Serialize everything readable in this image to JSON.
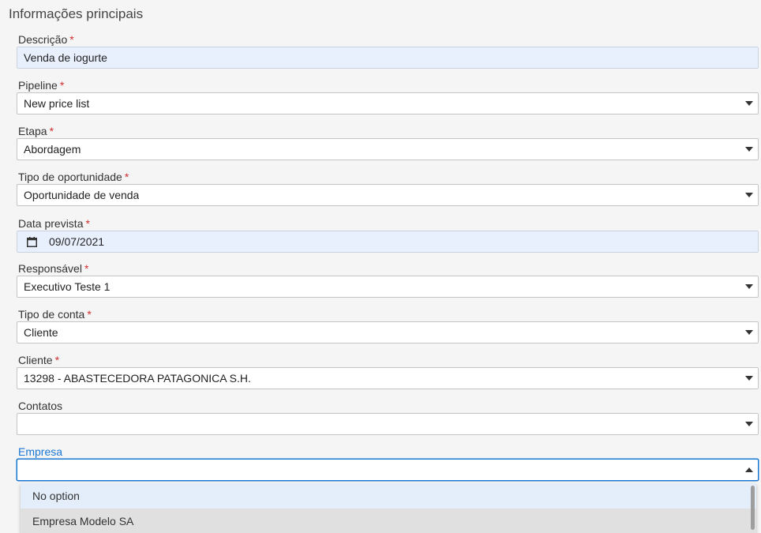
{
  "section": {
    "title": "Informações principais"
  },
  "required_marker": "*",
  "fields": {
    "descricao": {
      "label": "Descrição",
      "value": "Venda de iogurte"
    },
    "pipeline": {
      "label": "Pipeline",
      "value": "New price list"
    },
    "etapa": {
      "label": "Etapa",
      "value": "Abordagem"
    },
    "tipo_oportunidade": {
      "label": "Tipo de oportunidade",
      "value": "Oportunidade de venda"
    },
    "data_prevista": {
      "label": "Data prevista",
      "value": "09/07/2021",
      "icon": "calendar-icon"
    },
    "responsavel": {
      "label": "Responsável",
      "value": "Executivo Teste 1"
    },
    "tipo_conta": {
      "label": "Tipo de conta",
      "value": "Cliente"
    },
    "cliente": {
      "label": "Cliente",
      "value": "13298 - ABASTECEDORA PATAGONICA S.H."
    },
    "contatos": {
      "label": "Contatos",
      "value": ""
    },
    "empresa": {
      "label": "Empresa",
      "value": ""
    }
  },
  "empresa_dropdown": {
    "options": [
      {
        "label": "No option"
      },
      {
        "label": "Empresa Modelo SA"
      }
    ]
  },
  "colors": {
    "required": "#d32f2f",
    "focus": "#1976d2",
    "filled_background": "#e8f0fe"
  }
}
